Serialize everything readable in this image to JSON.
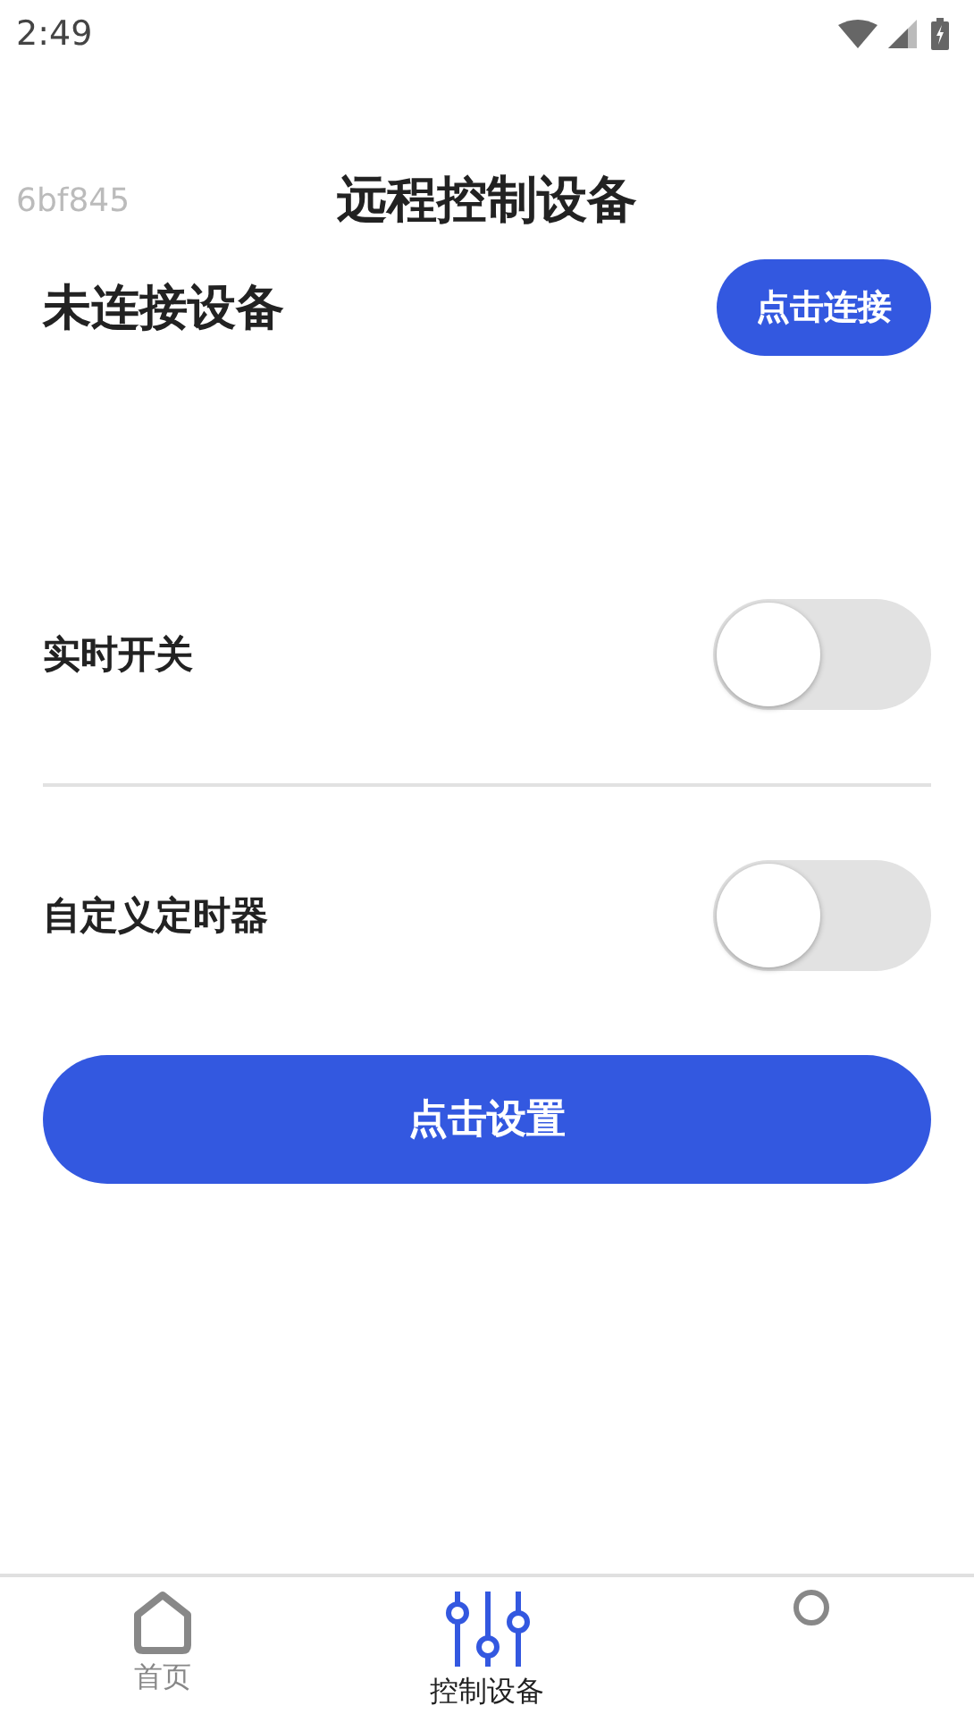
{
  "status_bar": {
    "time": "2:49"
  },
  "header": {
    "tag": "6bf845",
    "title": "远程控制设备"
  },
  "connection": {
    "status": "未连接设备",
    "button": "点击连接"
  },
  "settings": [
    {
      "label": "实时开关",
      "on": false
    },
    {
      "label": "自定义定时器",
      "on": false
    }
  ],
  "action_button": "点击设置",
  "tabs": [
    {
      "kind": "home",
      "label": "首页",
      "selected": false
    },
    {
      "kind": "sliders",
      "label": "控制设备",
      "selected": true
    },
    {
      "kind": "circle",
      "selected": false
    }
  ]
}
